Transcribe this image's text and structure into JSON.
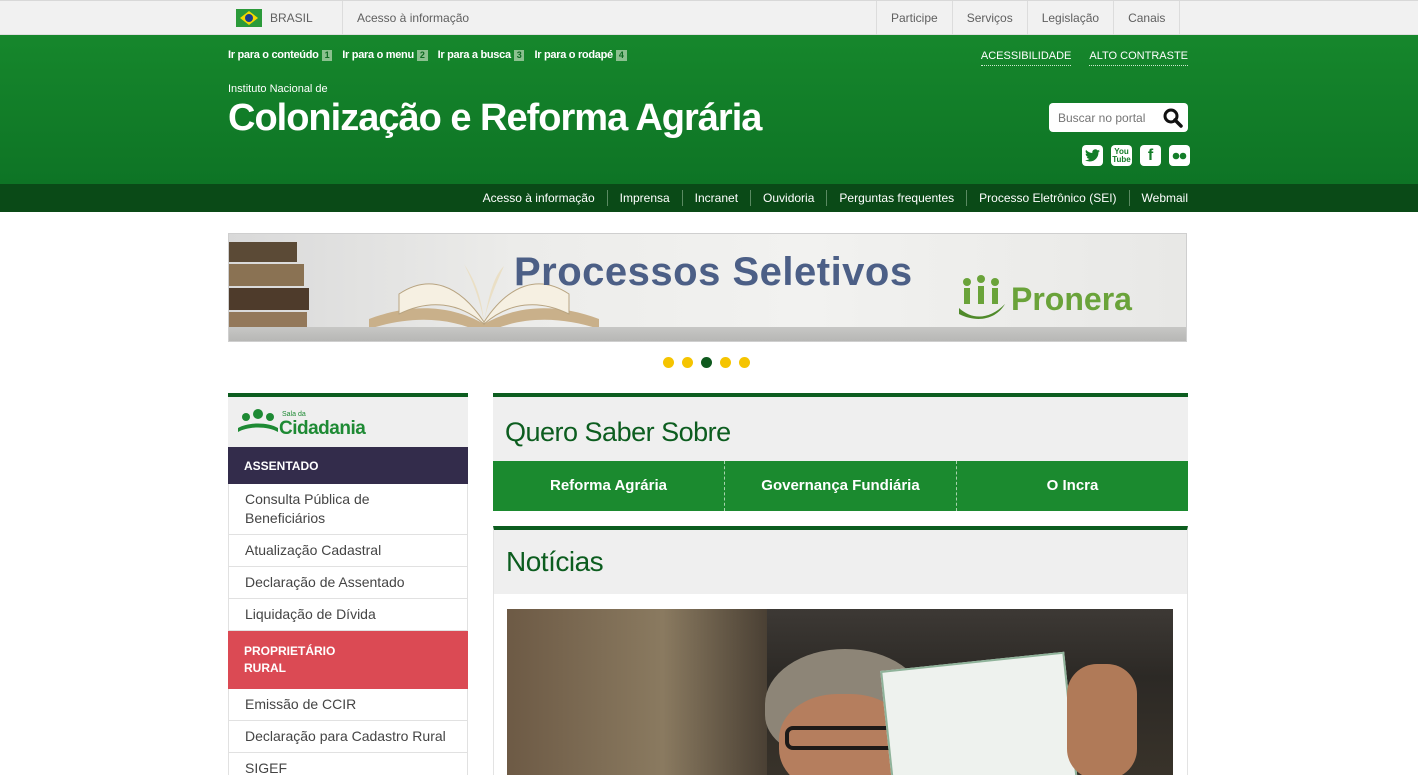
{
  "govbar": {
    "country": "BRASIL",
    "access_info": "Acesso à informação",
    "links": [
      "Participe",
      "Serviços",
      "Legislação",
      "Canais"
    ]
  },
  "header": {
    "skip_links": [
      {
        "label": "Ir para o conteúdo",
        "key": "1"
      },
      {
        "label": "Ir para o menu",
        "key": "2"
      },
      {
        "label": "Ir para a busca",
        "key": "3"
      },
      {
        "label": "Ir para o rodapé",
        "key": "4"
      }
    ],
    "accessibility": "ACESSIBILIDADE",
    "high_contrast": "ALTO CONTRASTE",
    "institution_small": "Instituto Nacional de",
    "institution_big": "Colonização e Reforma Agrária",
    "search_placeholder": "Buscar no portal",
    "social": [
      {
        "name": "twitter-icon",
        "glyph": "t"
      },
      {
        "name": "youtube-icon",
        "glyph": "You"
      },
      {
        "name": "facebook-icon",
        "glyph": "f"
      },
      {
        "name": "flickr-icon",
        "glyph": "●●"
      }
    ]
  },
  "subnav": [
    "Acesso à informação",
    "Imprensa",
    "Incranet",
    "Ouvidoria",
    "Perguntas frequentes",
    "Processo Eletrônico (SEI)",
    "Webmail"
  ],
  "banner": {
    "title": "Processos Seletivos",
    "brand": "Pronera",
    "slide_count": 5,
    "active_slide": 3
  },
  "sidebar": {
    "logo_small": "Sala da",
    "logo_big": "Cidadania",
    "section1": "ASSENTADO",
    "section1_items": [
      "Consulta Pública de Beneficiários",
      "Atualização Cadastral",
      "Declaração de Assentado",
      "Liquidação de Dívida"
    ],
    "section2_line1": "PROPRIETÁRIO",
    "section2_line2": "RURAL",
    "section2_items": [
      "Emissão de CCIR",
      "Declaração para Cadastro Rural",
      "SIGEF"
    ]
  },
  "quero": {
    "title": "Quero Saber Sobre",
    "tabs": [
      "Reforma Agrária",
      "Governança Fundiária",
      "O Incra"
    ]
  },
  "news": {
    "title": "Notícias"
  },
  "colors": {
    "header_green": "#16872c",
    "dark_green": "#0c5d1f",
    "subnav_green": "#0a4a17",
    "tab_green": "#1b8a2f",
    "purple": "#332c4b",
    "red": "#db4a54",
    "dot_yellow": "#f5c400"
  }
}
